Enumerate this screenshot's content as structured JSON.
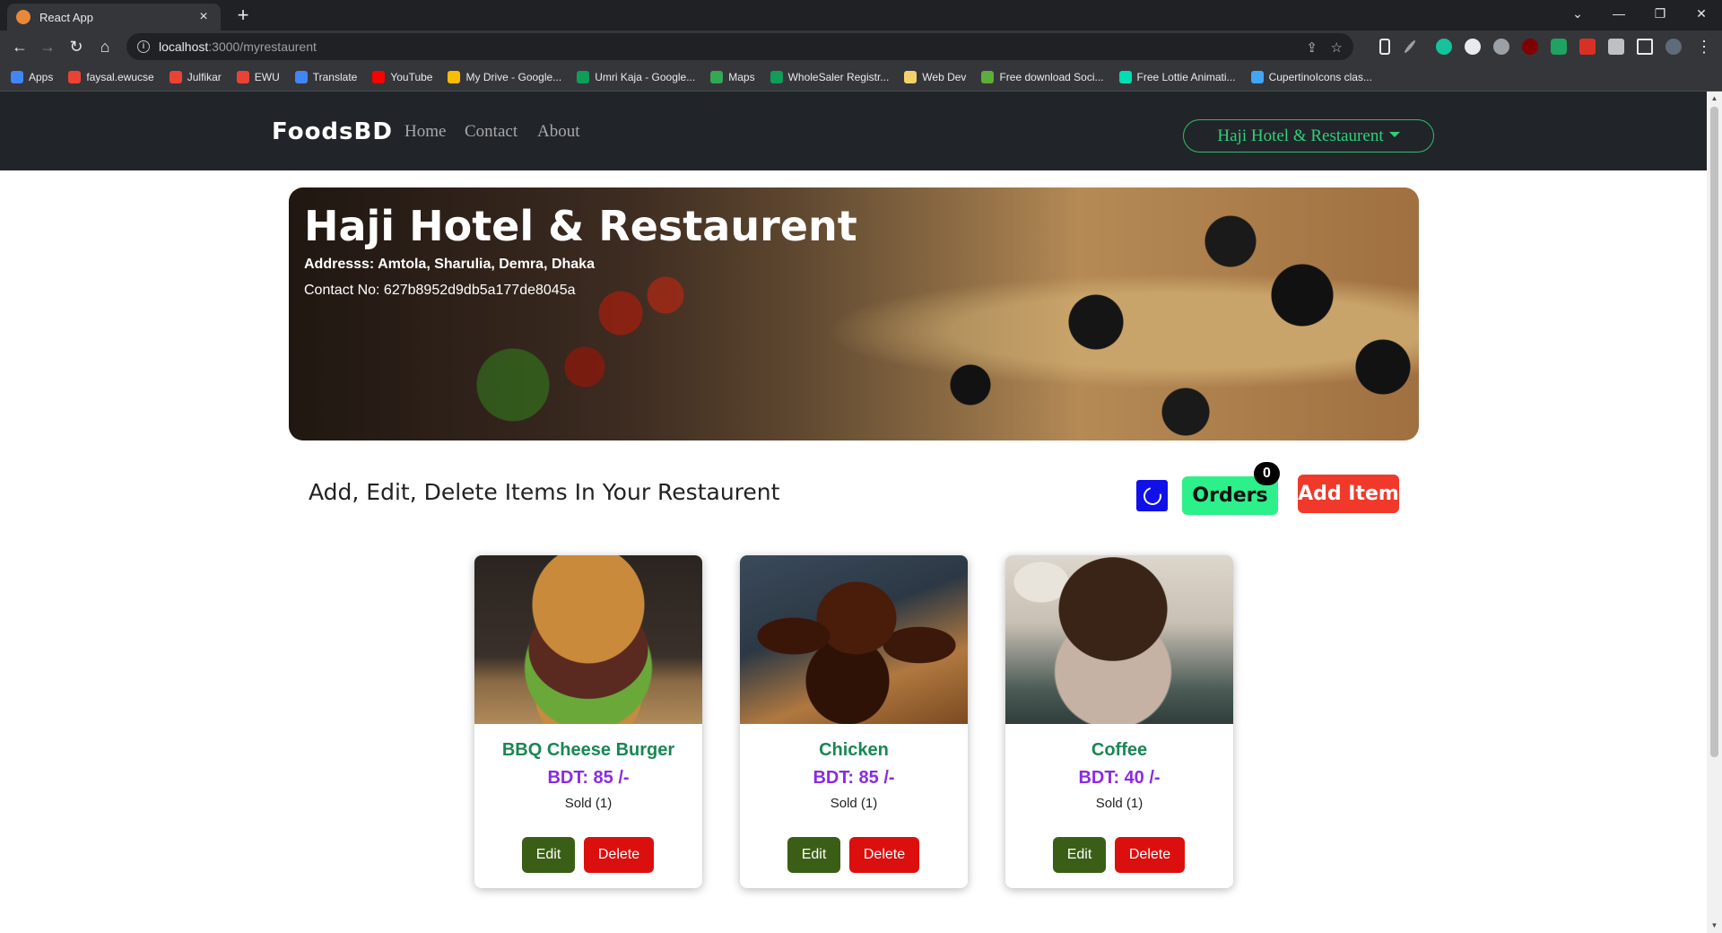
{
  "browser": {
    "tab_title": "React App",
    "tab_close": "×",
    "new_tab": "+",
    "url_host": "localhost",
    "url_path": ":3000/myrestaurent",
    "bookmarks": [
      {
        "label": "Apps",
        "icon": "apps-grid-icon",
        "color": "#4285f4"
      },
      {
        "label": "faysal.ewucse",
        "icon": "gmail-icon",
        "color": "#ea4335"
      },
      {
        "label": "Julfikar",
        "icon": "gmail-icon",
        "color": "#ea4335"
      },
      {
        "label": "EWU",
        "icon": "gmail-icon",
        "color": "#ea4335"
      },
      {
        "label": "Translate",
        "icon": "translate-icon",
        "color": "#4285f4"
      },
      {
        "label": "YouTube",
        "icon": "youtube-icon",
        "color": "#ff0000"
      },
      {
        "label": "My Drive - Google...",
        "icon": "drive-icon",
        "color": "#fbbc04"
      },
      {
        "label": "Umri Kaja - Google...",
        "icon": "sheets-icon",
        "color": "#0f9d58"
      },
      {
        "label": "Maps",
        "icon": "maps-icon",
        "color": "#34a853"
      },
      {
        "label": "WholeSaler Registr...",
        "icon": "sheets-icon",
        "color": "#0f9d58"
      },
      {
        "label": "Web Dev",
        "icon": "folder-icon",
        "color": "#f2d16b"
      },
      {
        "label": "Free download Soci...",
        "icon": "leaf-icon",
        "color": "#5cae3c"
      },
      {
        "label": "Free Lottie Animati...",
        "icon": "lottie-icon",
        "color": "#00ddb3"
      },
      {
        "label": "CupertinoIcons clas...",
        "icon": "flutter-icon",
        "color": "#42a5f5"
      }
    ]
  },
  "navbar": {
    "brand": "FoodsBD",
    "links": [
      "Home",
      "Contact",
      "About"
    ],
    "dropdown_label": "Haji Hotel & Restaurent"
  },
  "hero": {
    "title": "Haji Hotel & Restaurent",
    "address": "Addresss: Amtola, Sharulia, Demra, Dhaka",
    "contact": "Contact No: 627b8952d9db5a177de8045a"
  },
  "actions": {
    "section_title": "Add, Edit, Delete Items In Your Restaurent",
    "orders_label": "Orders",
    "orders_count": "0",
    "add_item_label": "Add Item"
  },
  "items": [
    {
      "name": "BBQ Cheese Burger",
      "price": "BDT: 85 /-",
      "sold": "Sold (1)",
      "edit": "Edit",
      "delete": "Delete"
    },
    {
      "name": "Chicken",
      "price": "BDT: 85 /-",
      "sold": "Sold (1)",
      "edit": "Edit",
      "delete": "Delete"
    },
    {
      "name": "Coffee",
      "price": "BDT: 40 /-",
      "sold": "Sold (1)",
      "edit": "Edit",
      "delete": "Delete"
    }
  ],
  "colors": {
    "navbar_bg": "#212529",
    "accent_green": "#2fd07a",
    "item_name": "#198754",
    "item_price": "#8a2be2",
    "orders_bg": "#2cf08a",
    "add_item_bg": "#f0392a",
    "refresh_bg": "#1010e8",
    "edit_bg": "#3b5e17",
    "delete_bg": "#dc0f0f"
  }
}
